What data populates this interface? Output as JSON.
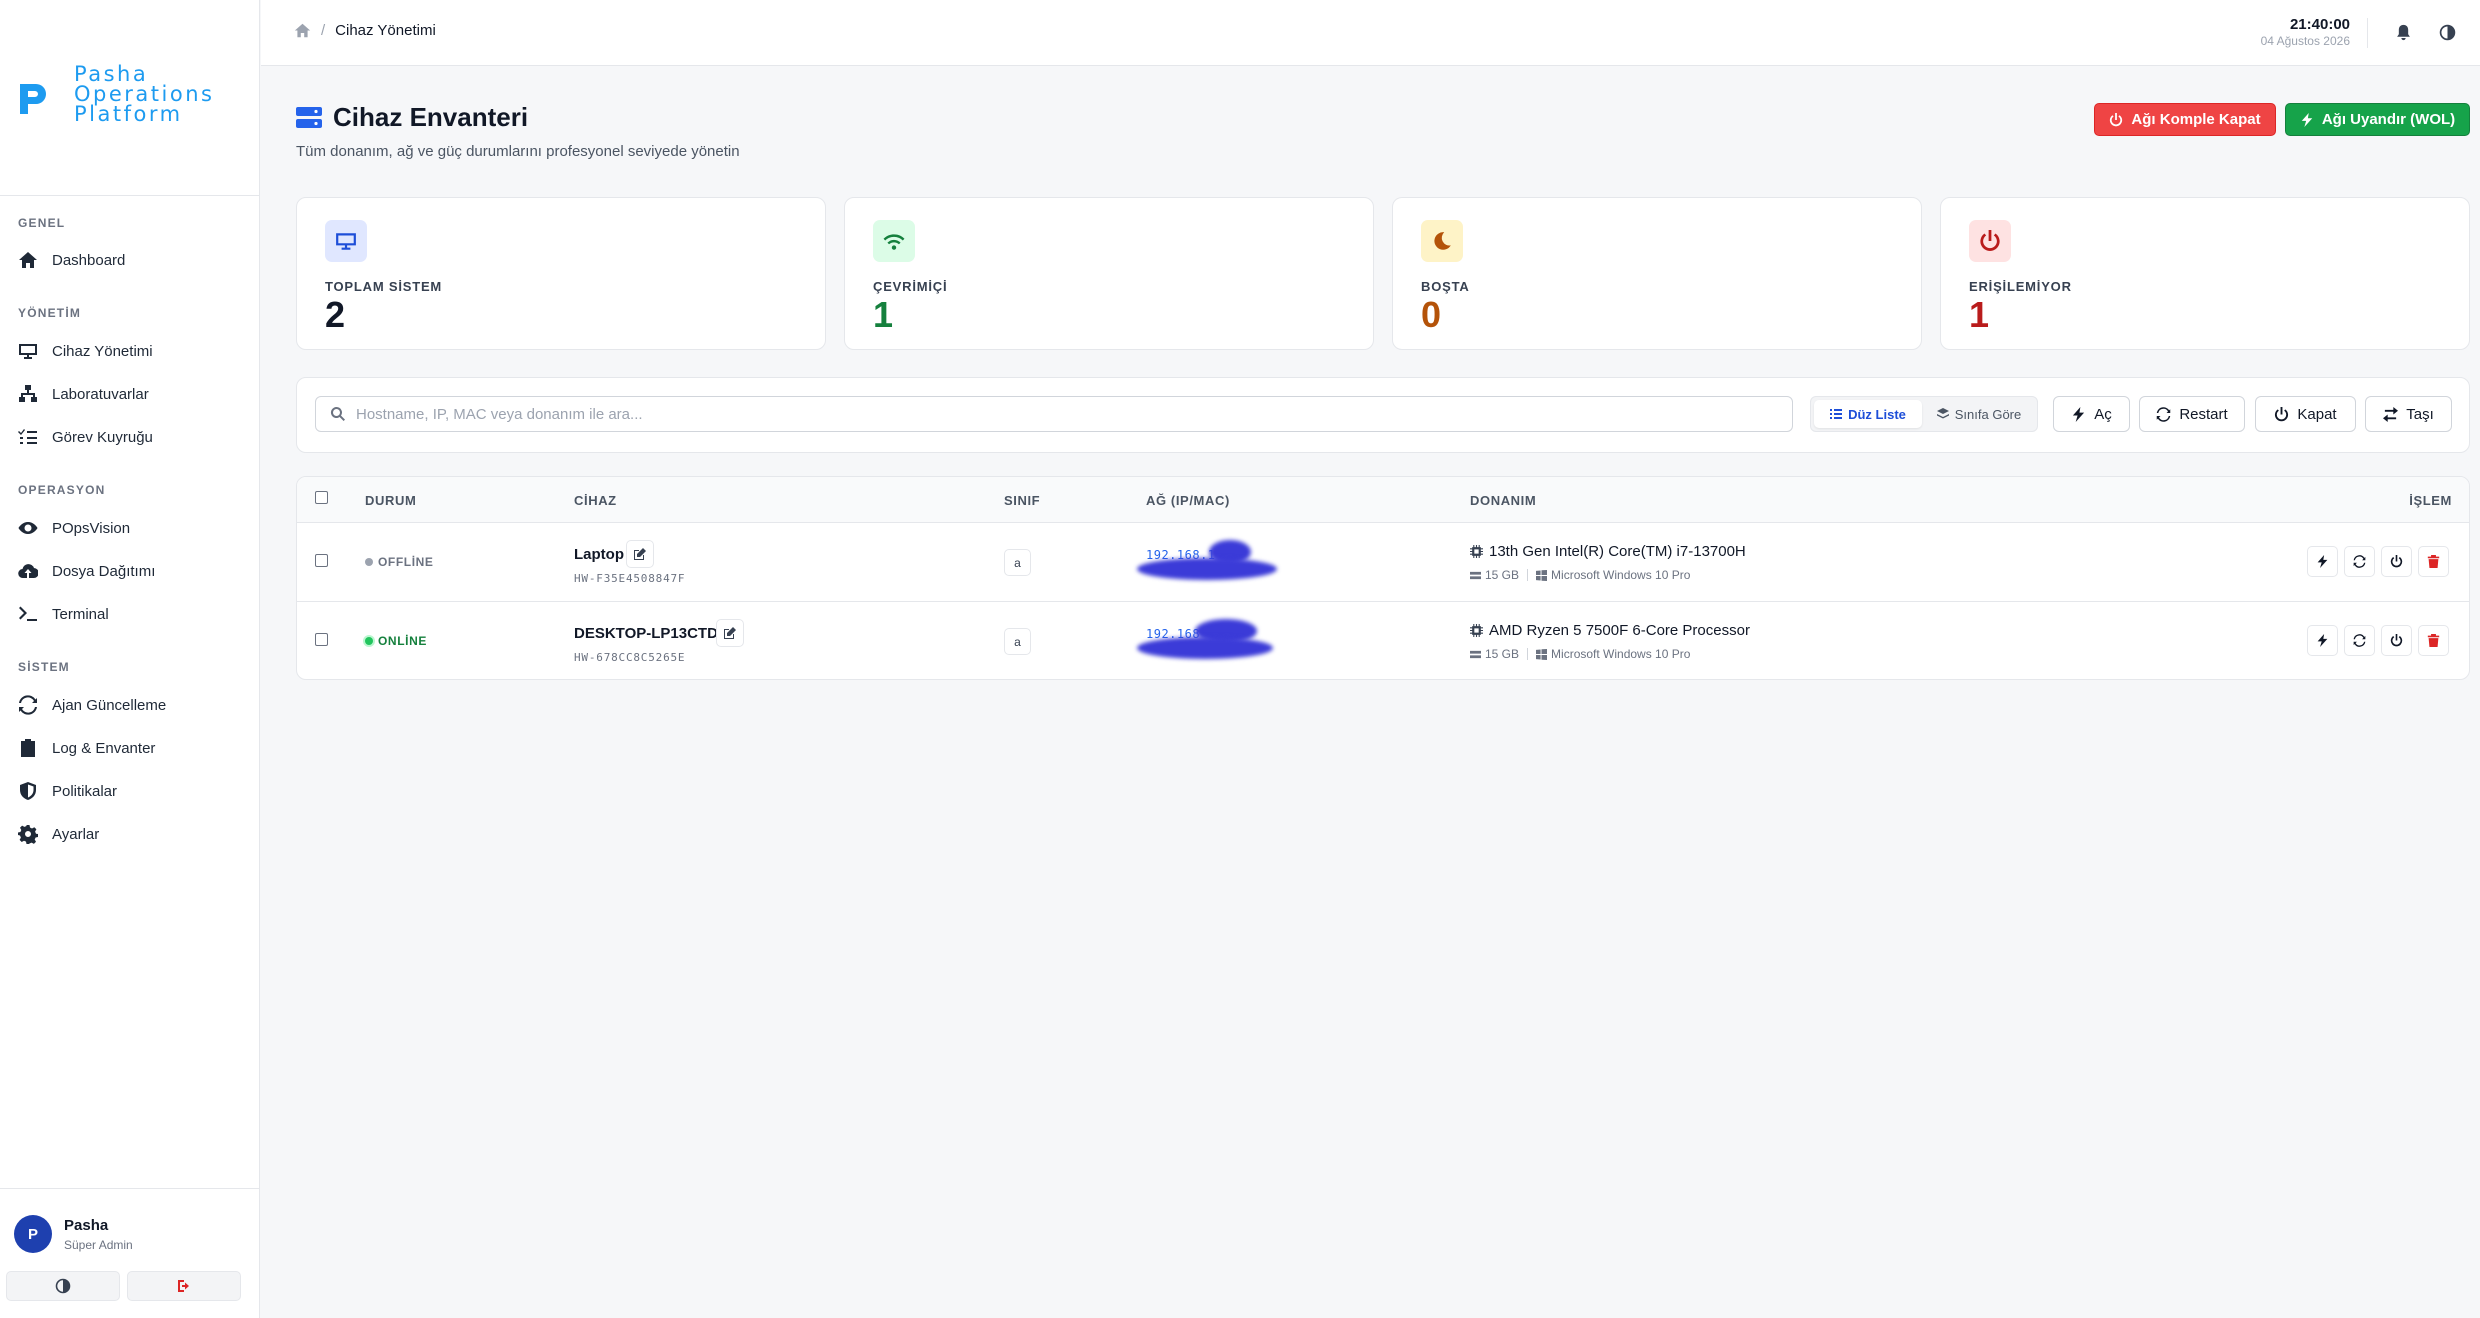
{
  "brand": {
    "line1": "Pasha",
    "line2": "Operations",
    "line3": "Platform",
    "color": "#1d9bf0"
  },
  "sidebar": {
    "sections": [
      {
        "label": "GENEL"
      },
      {
        "label": "YÖNETİM"
      },
      {
        "label": "OPERASYON"
      },
      {
        "label": "SİSTEM"
      }
    ],
    "items": [
      {
        "label": "Dashboard",
        "icon": "home-icon"
      },
      {
        "label": "Cihaz Yönetimi",
        "icon": "monitor-icon"
      },
      {
        "label": "Laboratuvarlar",
        "icon": "network-icon"
      },
      {
        "label": "Görev Kuyruğu",
        "icon": "list-check-icon"
      },
      {
        "label": "POpsVision",
        "icon": "eye-icon"
      },
      {
        "label": "Dosya Dağıtımı",
        "icon": "cloud-upload-icon"
      },
      {
        "label": "Terminal",
        "icon": "terminal-icon"
      },
      {
        "label": "Ajan Güncelleme",
        "icon": "sync-icon"
      },
      {
        "label": "Log & Envanter",
        "icon": "clipboard-icon"
      },
      {
        "label": "Politikalar",
        "icon": "shield-icon"
      },
      {
        "label": "Ayarlar",
        "icon": "gear-icon"
      }
    ]
  },
  "user": {
    "initial": "P",
    "name": "Pasha",
    "role": "Süper Admin"
  },
  "topbar": {
    "breadcrumb_current": "Cihaz Yönetimi",
    "breadcrumb_sep": "/",
    "time": "21:40:00",
    "date": "04 Ağustos 2026"
  },
  "header": {
    "title": "Cihaz Envanteri",
    "subtitle": "Tüm donanım, ağ ve güç durumlarını profesyonel seviyede yönetin",
    "btn_shutdown_all": "Ağı Komple Kapat",
    "btn_wol": "Ağı Uyandır (WOL)"
  },
  "stats": [
    {
      "label": "TOPLAM SİSTEM",
      "value": "2",
      "color": "#111827",
      "icon": "monitor-icon"
    },
    {
      "label": "ÇEVRİMİÇİ",
      "value": "1",
      "color": "#15803d",
      "icon": "wifi-icon"
    },
    {
      "label": "BOŞTA",
      "value": "0",
      "color": "#b45309",
      "icon": "moon-icon"
    },
    {
      "label": "ERİŞİLEMİYOR",
      "value": "1",
      "color": "#b91c1c",
      "icon": "power-icon"
    }
  ],
  "toolbar": {
    "search_placeholder": "Hostname, IP, MAC veya donanım ile ara...",
    "search_value": "",
    "view_list": "Düz Liste",
    "view_class": "Sınıfa Göre",
    "btn_on": "Aç",
    "btn_restart": "Restart",
    "btn_off": "Kapat",
    "btn_move": "Taşı"
  },
  "table": {
    "columns": [
      "DURUM",
      "CİHAZ",
      "SINIF",
      "AĞ (IP/MAC)",
      "DONANIM",
      "İŞLEM"
    ],
    "rows": [
      {
        "status": "OFFLİNE",
        "status_color": "#9ca3af",
        "name": "Laptop",
        "hw_id": "HW-F35E4508847F",
        "class": "a",
        "ip": "192.168.1",
        "cpu": "13th Gen Intel(R) Core(TM) i7-13700H",
        "ram": "15 GB",
        "os": "Microsoft Windows 10 Pro"
      },
      {
        "status": "ONLİNE",
        "status_color": "#22c55e",
        "name": "DESKTOP-LP13CTD",
        "hw_id": "HW-678CC8C5265E",
        "class": "a",
        "ip": "192.168",
        "cpu": "AMD Ryzen 5 7500F 6-Core Processor",
        "ram": "15 GB",
        "os": "Microsoft Windows 10 Pro"
      }
    ]
  }
}
